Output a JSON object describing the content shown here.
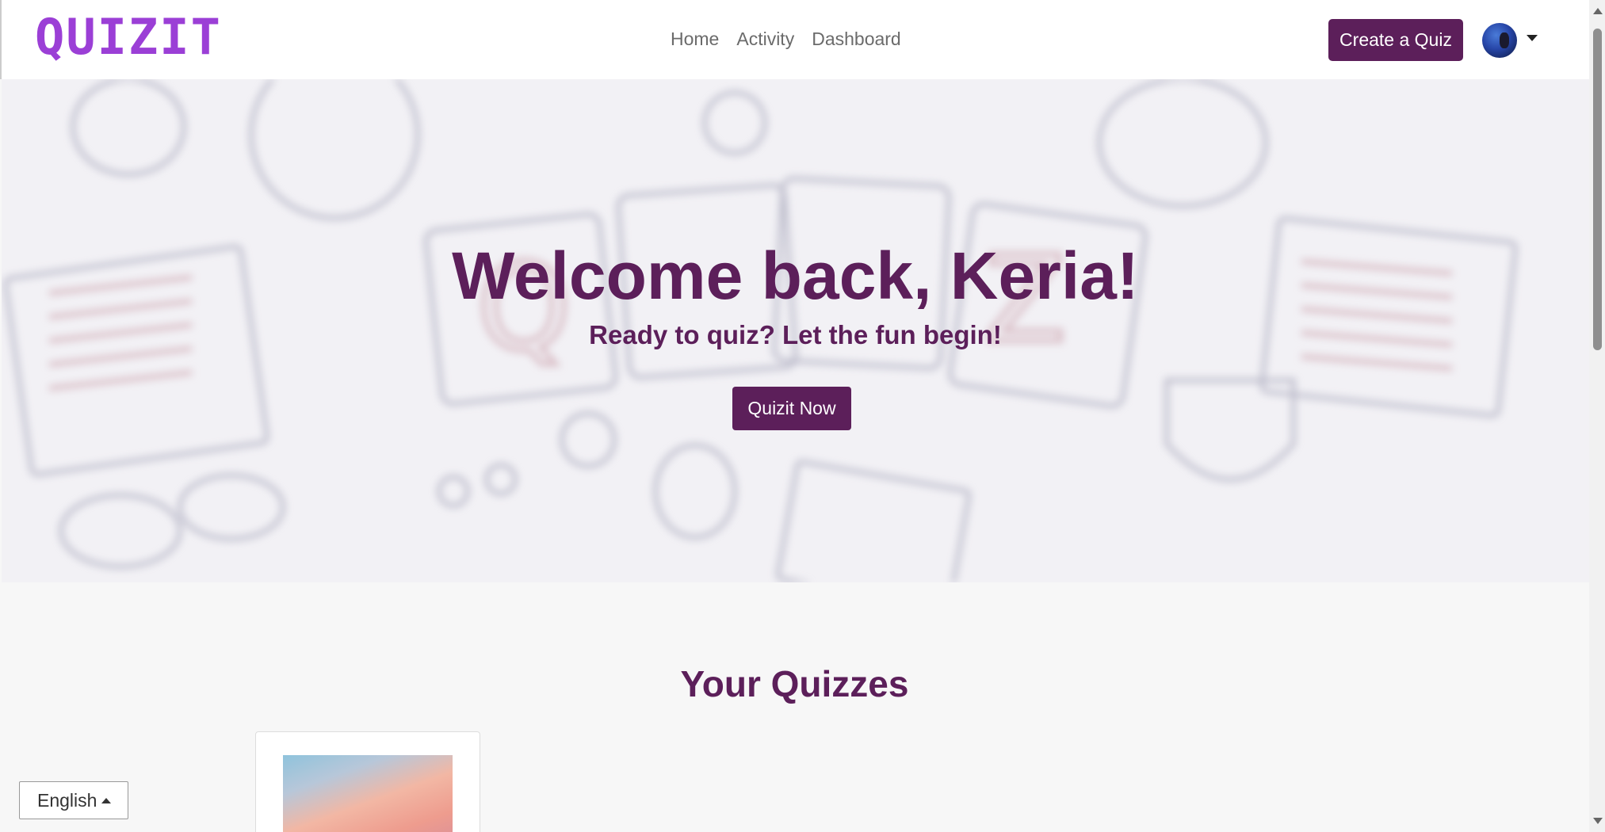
{
  "nav": {
    "logo": "QUIZIT",
    "links": [
      "Home",
      "Activity",
      "Dashboard"
    ],
    "create_button": "Create a Quiz"
  },
  "hero": {
    "title": "Welcome back, Keria!",
    "subtitle": "Ready to quiz? Let the fun begin!",
    "cta": "Quizit Now"
  },
  "quizzes": {
    "title": "Your Quizzes"
  },
  "language": {
    "selected": "English"
  },
  "colors": {
    "brand": "#5c1f5a",
    "logo": "#9b3fd6"
  }
}
